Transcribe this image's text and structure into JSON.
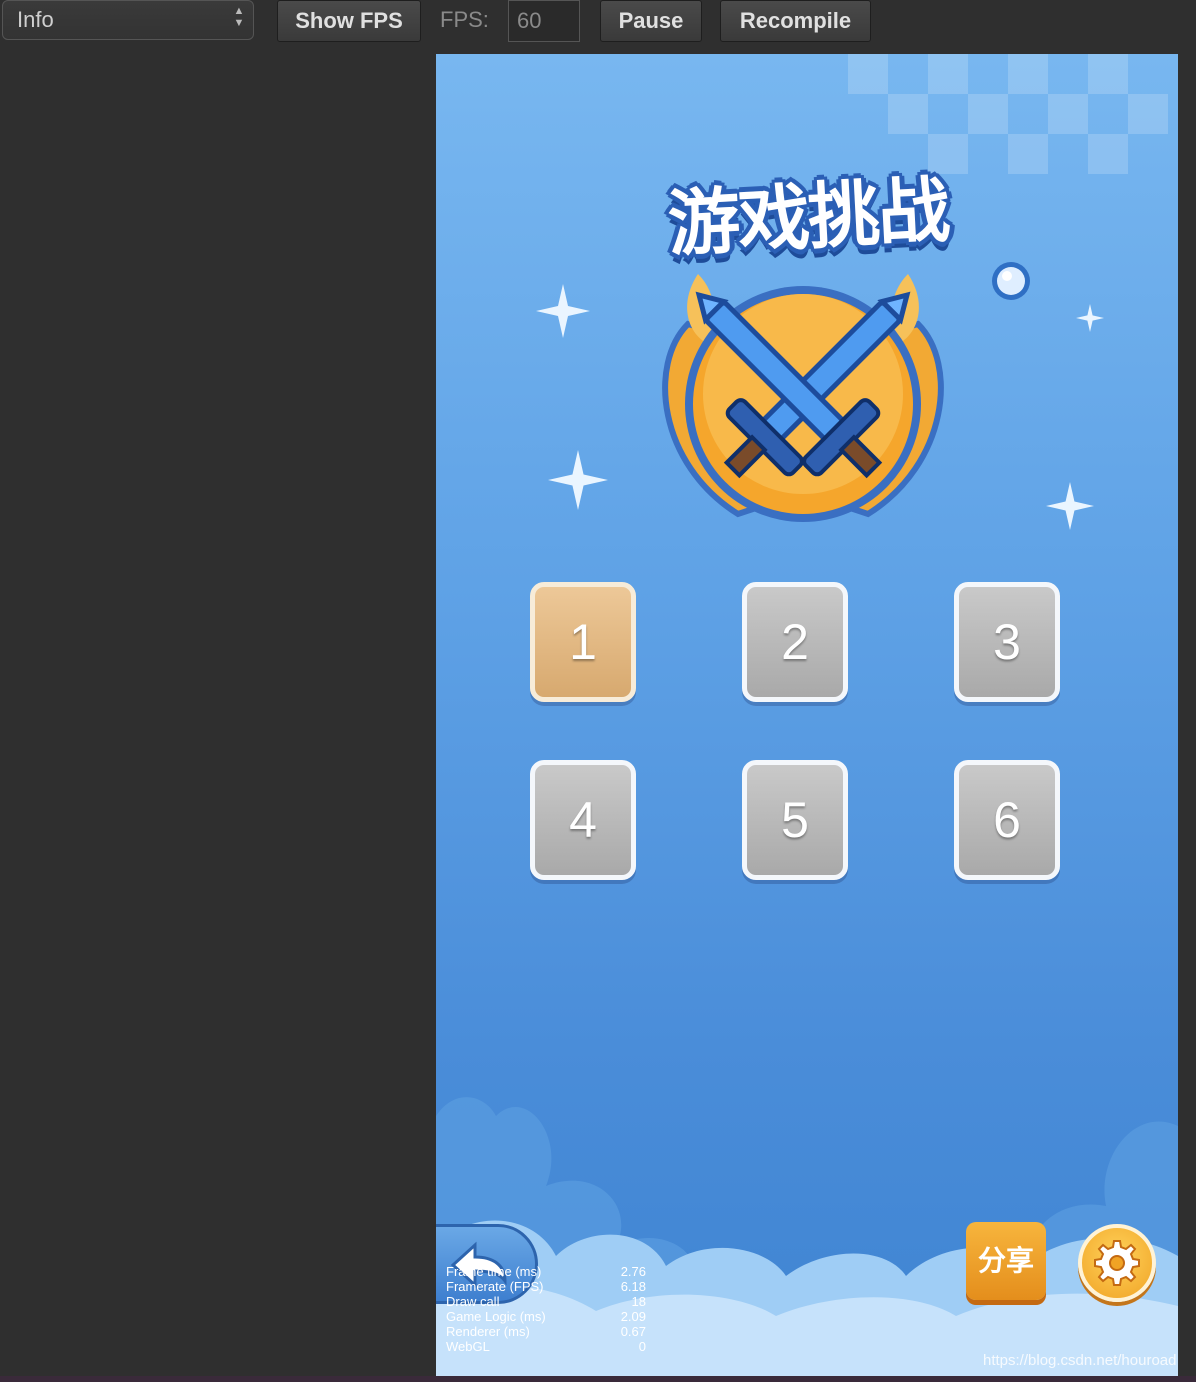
{
  "toolbar": {
    "mode_select": "Info",
    "show_fps_label": "Show FPS",
    "fps_label": "FPS:",
    "fps_value": "60",
    "pause_label": "Pause",
    "recompile_label": "Recompile"
  },
  "game": {
    "title": "游戏挑战",
    "levels": [
      {
        "label": "1",
        "state": "selected"
      },
      {
        "label": "2",
        "state": "locked"
      },
      {
        "label": "3",
        "state": "locked"
      },
      {
        "label": "4",
        "state": "locked"
      },
      {
        "label": "5",
        "state": "locked"
      },
      {
        "label": "6",
        "state": "locked"
      }
    ],
    "share_label": "分享",
    "icons": {
      "back": "back-arrow-icon",
      "settings": "gear-icon",
      "emblem": "crossed-swords-icon"
    },
    "colors": {
      "selected_level": "#d7a96f",
      "locked_level": "#b5b5b5",
      "share_button": "#f0a325",
      "background_top": "#78b7f0",
      "background_bottom": "#3f84d2"
    }
  },
  "stats": [
    {
      "label": "Frame time (ms)",
      "value": "2.76"
    },
    {
      "label": "Framerate (FPS)",
      "value": "6.18"
    },
    {
      "label": "Draw call",
      "value": "18"
    },
    {
      "label": "Game Logic (ms)",
      "value": "2.09"
    },
    {
      "label": "Renderer (ms)",
      "value": "0.67"
    },
    {
      "label": "WebGL",
      "value": "0"
    }
  ],
  "watermark": "https://blog.csdn.net/houroad"
}
